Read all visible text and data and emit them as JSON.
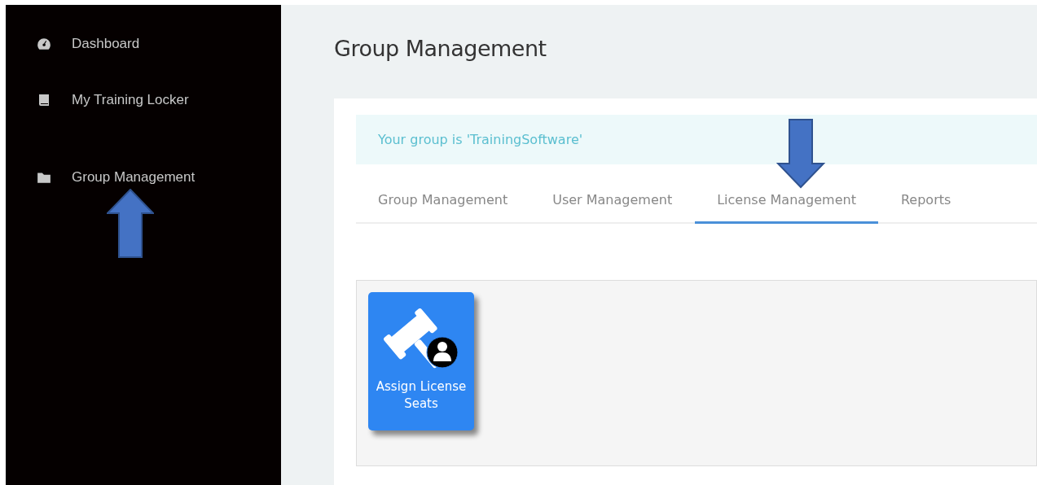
{
  "sidebar": {
    "items": [
      {
        "label": "Dashboard",
        "kind": "gauge"
      },
      {
        "label": "My Training Locker",
        "kind": "book"
      },
      {
        "label": "Group Management",
        "kind": "folder"
      }
    ]
  },
  "page_title": "Group Management",
  "alert": "Your group is 'TrainingSoftware'",
  "tabs": [
    {
      "label": "Group Management",
      "selected": false
    },
    {
      "label": "User Management",
      "selected": false
    },
    {
      "label": "License Management",
      "selected": true
    },
    {
      "label": "Reports",
      "selected": false
    }
  ],
  "tiles": [
    {
      "label": "Assign License Seats"
    }
  ]
}
